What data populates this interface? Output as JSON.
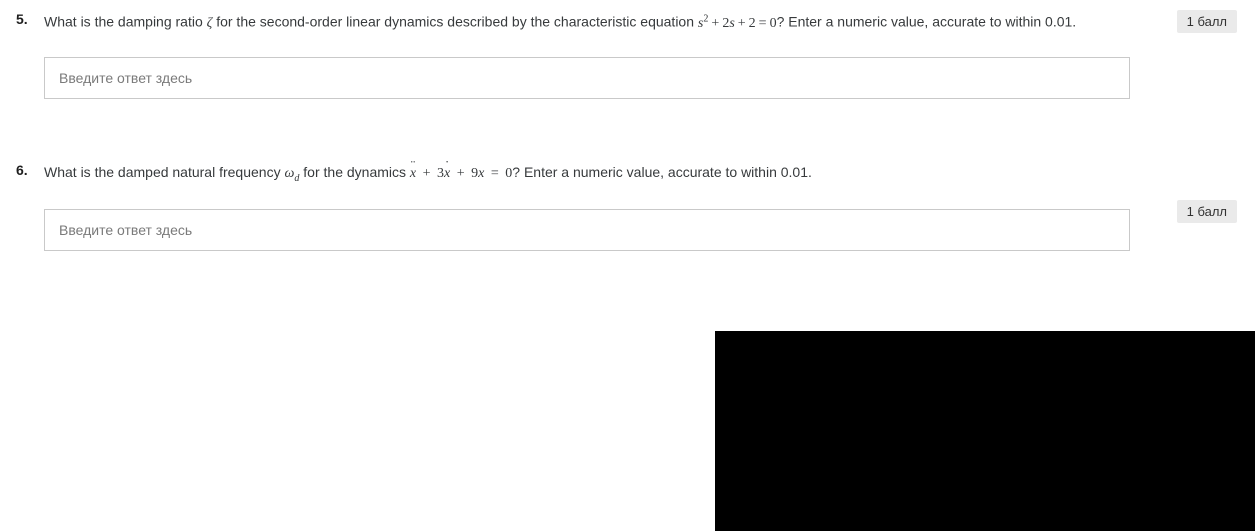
{
  "questions": [
    {
      "number": "5.",
      "text_before_eq": "What is the damping ratio ",
      "zeta": "ζ",
      "text_mid": " for the second-order linear dynamics described by the characteristic equation ",
      "eq_html": "s<sup>2</sup> + 2s + 2 = 0",
      "text_after_eq": "?  Enter a numeric value, accurate to within 0.01.",
      "placeholder": "Введите ответ здесь",
      "points": "1 балл"
    },
    {
      "number": "6.",
      "text_before_eq": "What is the damped natural frequency ",
      "omega": "ω",
      "omega_sub": "d",
      "text_mid": " for the dynamics ",
      "eq_parts": {
        "xddot": "x",
        "plus1": " + ",
        "three": "3",
        "xdot": "x",
        "plus2": " + ",
        "nine": "9",
        "x": "x",
        "eq": " = ",
        "zero": "0"
      },
      "text_after_eq": "?  Enter a numeric value, accurate to within 0.01.",
      "placeholder": "Введите ответ здесь",
      "points": "1 балл"
    }
  ]
}
